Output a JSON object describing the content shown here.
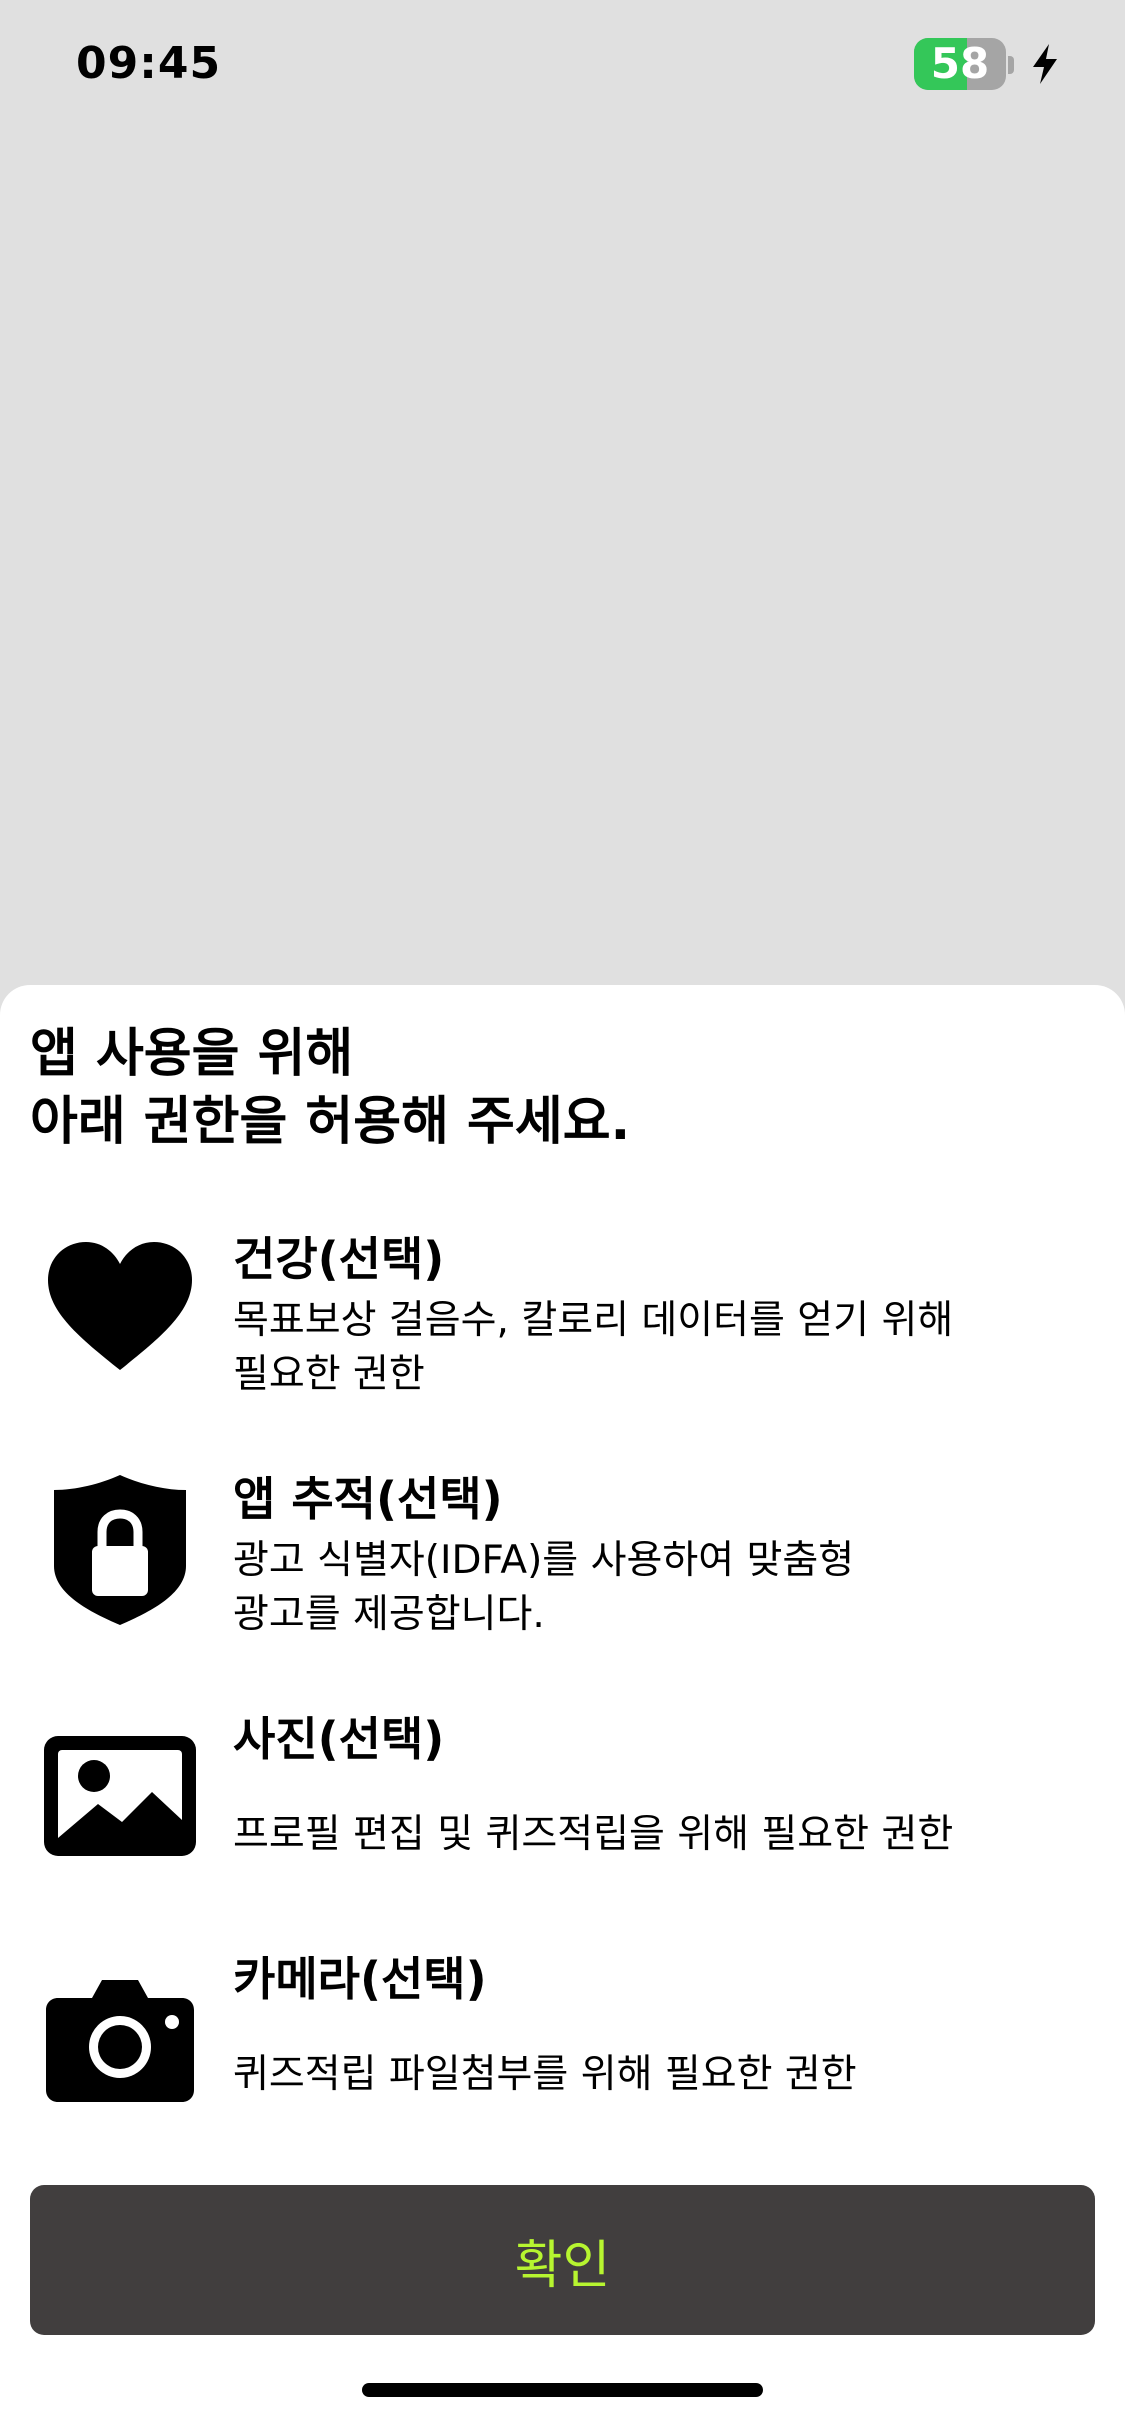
{
  "status_bar": {
    "time": "09:45",
    "battery_level": "58",
    "battery_percent": 58,
    "battery_color": "#34c759",
    "charging_icon": "bolt-icon"
  },
  "sheet": {
    "title": "앱 사용을 위해\n아래 권한을 허용해 주세요.",
    "permissions": [
      {
        "icon": "heart-icon",
        "title": "건강(선택)",
        "description": "목표보상 걸음수, 칼로리 데이터를 얻기 위해\n필요한 권한"
      },
      {
        "icon": "shield-lock-icon",
        "title": "앱 추적(선택)",
        "description": "광고 식별자(IDFA)를 사용하여 맞춤형\n광고를 제공합니다."
      },
      {
        "icon": "photo-icon",
        "title": "사진(선택)",
        "description": "프로필 편집 및 퀴즈적립을 위해 필요한 권한"
      },
      {
        "icon": "camera-icon",
        "title": "카메라(선택)",
        "description": "퀴즈적립 파일첨부를 위해 필요한 권한"
      }
    ],
    "confirm_label": "확인"
  },
  "colors": {
    "backdrop": "#e0e0e0",
    "sheet_background": "#ffffff",
    "button_background": "#413e3e",
    "button_text": "#b7f530"
  }
}
